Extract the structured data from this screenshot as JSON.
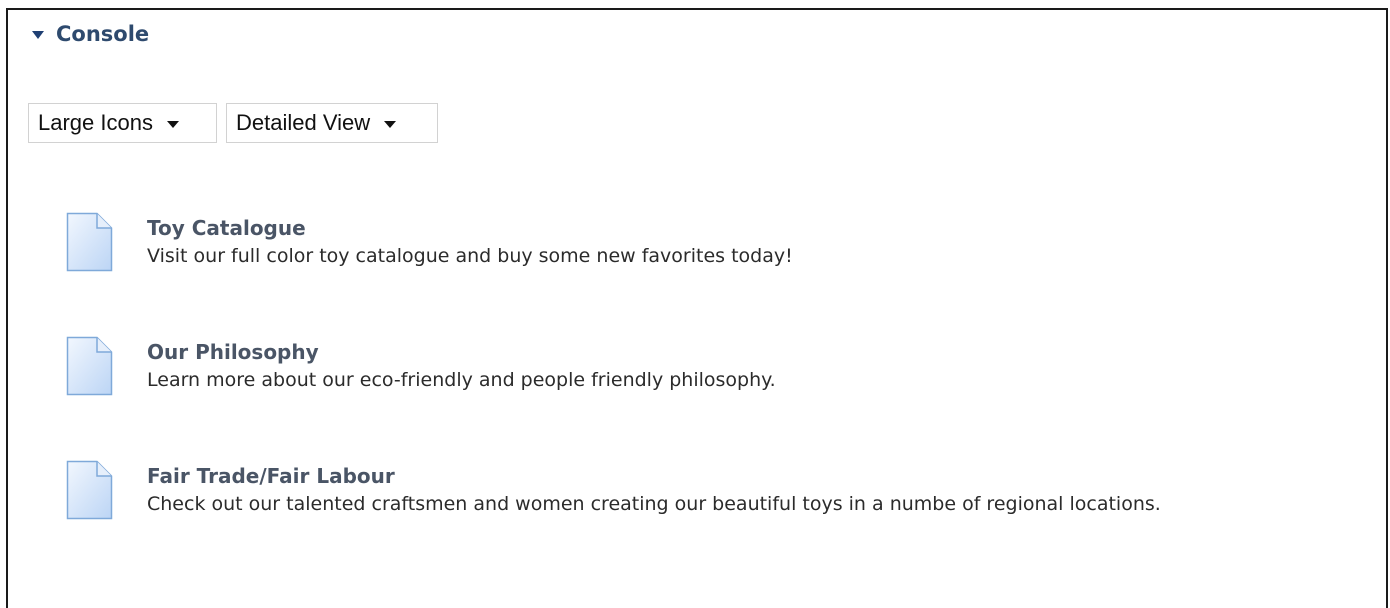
{
  "console": {
    "title": "Console",
    "view_size": {
      "selected": "Large Icons"
    },
    "view_mode": {
      "selected": "Detailed View"
    },
    "items": [
      {
        "title": "Toy Catalogue",
        "description": "Visit our full color toy catalogue and buy some new favorites today!",
        "icon": "document-icon"
      },
      {
        "title": "Our Philosophy",
        "description": "Learn more about our eco-friendly and people friendly philosophy.",
        "icon": "document-icon"
      },
      {
        "title": "Fair Trade/Fair Labour",
        "description": "Check out our talented craftsmen and women creating our beautiful toys in a numbe of regional locations.",
        "icon": "document-icon"
      }
    ]
  },
  "colors": {
    "header_text": "#2e4a6e",
    "caret": "#1f3f73",
    "item_title": "#4a5566",
    "icon_fill": "#dce9fb",
    "icon_border": "#7fa9d9"
  }
}
